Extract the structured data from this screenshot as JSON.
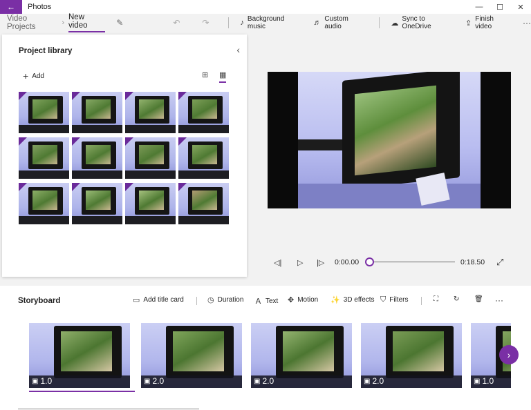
{
  "window": {
    "app_title": "Photos",
    "back_icon": "back-arrow-icon",
    "controls": {
      "minimize": "—",
      "maximize": "☐",
      "close": "✕"
    }
  },
  "toolbar": {
    "breadcrumb_root": "Video Projects",
    "breadcrumb_current": "New video",
    "actions": {
      "background_music": "Background music",
      "custom_audio": "Custom audio",
      "sync": "Sync to OneDrive",
      "finish": "Finish video"
    },
    "more": "···"
  },
  "library": {
    "title": "Project library",
    "add_label": "Add",
    "thumbnails": [
      {
        "screen": "#7fa35c"
      },
      {
        "screen": "#87a965"
      },
      {
        "screen": "#93b36e"
      },
      {
        "screen": "#7d9f58"
      },
      {
        "screen": "#829f60"
      },
      {
        "screen": "#8aa963"
      },
      {
        "screen": "#7c9a57"
      },
      {
        "screen": "#86a65f"
      },
      {
        "screen": "#8daf68"
      },
      {
        "screen": "#9cbd78"
      },
      {
        "screen": "#a6c27f"
      },
      {
        "screen": "#b39c74"
      }
    ]
  },
  "playback": {
    "current_time": "0:00.00",
    "total_time": "0:18.50"
  },
  "storyboard": {
    "title": "Storyboard",
    "tools": {
      "add_title_card": "Add title card",
      "duration": "Duration",
      "text": "Text",
      "motion": "Motion",
      "effects_3d": "3D effects",
      "filters": "Filters"
    },
    "more": "···",
    "clips": [
      {
        "duration": "1.0",
        "screen": "#8fae6a"
      },
      {
        "duration": "2.0",
        "screen": "#7fa55b"
      },
      {
        "duration": "2.0",
        "screen": "#94b470"
      },
      {
        "duration": "2.0",
        "screen": "#7a9c56"
      },
      {
        "duration": "1.0",
        "screen": "#86a661"
      }
    ]
  },
  "colors": {
    "accent": "#7a2fa5"
  }
}
